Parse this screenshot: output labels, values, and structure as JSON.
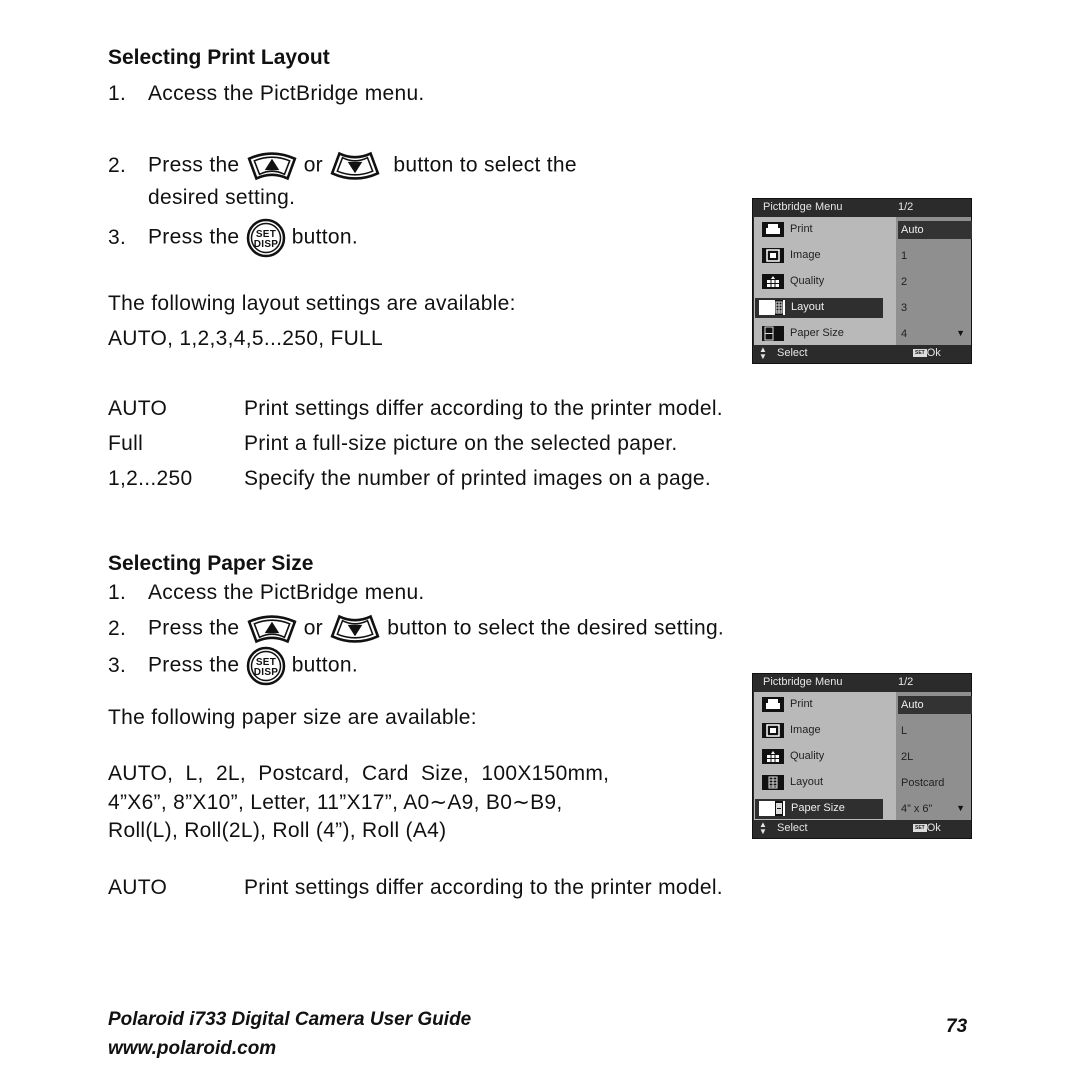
{
  "section1": {
    "heading": "Selecting Print Layout",
    "steps": [
      {
        "num": "1.",
        "text": "Access the PictBridge menu."
      },
      {
        "num": "2.",
        "pre": "Press the",
        "mid": "or",
        "post": "button to select the",
        "cont": "desired setting."
      },
      {
        "num": "3.",
        "pre": "Press the",
        "post": "button."
      }
    ],
    "intro": "The following layout settings are available:",
    "options": "AUTO, 1,2,3,4,5...250, FULL",
    "definitions": [
      {
        "term": "AUTO",
        "desc": "Print settings differ according to the printer model."
      },
      {
        "term": "Full",
        "desc": "Print a full-size picture on the selected paper."
      },
      {
        "term": "1,2...250",
        "desc": "Specify the number of printed images on a page."
      }
    ],
    "menu": {
      "title": "Pictbridge Menu",
      "page": "1/2",
      "items": [
        {
          "label": "Print",
          "icon": "printer-icon"
        },
        {
          "label": "Image",
          "icon": "image-icon"
        },
        {
          "label": "Quality",
          "icon": "quality-icon"
        },
        {
          "label": "Layout",
          "icon": "layout-icon"
        },
        {
          "label": "Paper Size",
          "icon": "paper-size-icon"
        }
      ],
      "selected_index": 3,
      "values": [
        "Auto",
        "1",
        "2",
        "3",
        "4"
      ],
      "selected_value_index": 0,
      "footer_select": "Select",
      "footer_set": "SET",
      "footer_ok": "Ok"
    }
  },
  "section2": {
    "heading": "Selecting Paper Size",
    "steps": [
      {
        "num": "1.",
        "text": "Access the PictBridge menu."
      },
      {
        "num": "2.",
        "pre": "Press the",
        "mid": "or",
        "post": "button to select the desired setting."
      },
      {
        "num": "3.",
        "pre": "Press the",
        "post": "button."
      }
    ],
    "intro": "The following paper size are available:",
    "options_lines": [
      "AUTO,  L,  2L,  Postcard,  Card  Size,  100X150mm,",
      "4”X6”, 8”X10”, Letter, 11”X17”, A0∼A9, B0∼B9,",
      "Roll(L), Roll(2L), Roll (4”), Roll (A4)"
    ],
    "definitions": [
      {
        "term": "AUTO",
        "desc": "Print settings differ according to the printer model."
      }
    ],
    "menu": {
      "title": "Pictbridge Menu",
      "page": "1/2",
      "items": [
        {
          "label": "Print",
          "icon": "printer-icon"
        },
        {
          "label": "Image",
          "icon": "image-icon"
        },
        {
          "label": "Quality",
          "icon": "quality-icon"
        },
        {
          "label": "Layout",
          "icon": "layout-icon"
        },
        {
          "label": "Paper Size",
          "icon": "paper-size-icon"
        }
      ],
      "selected_index": 4,
      "values": [
        "Auto",
        "L",
        "2L",
        "Postcard",
        "4” x 6”"
      ],
      "selected_value_index": 0,
      "footer_select": "Select",
      "footer_set": "SET",
      "footer_ok": "Ok"
    }
  },
  "footer": {
    "title": "Polaroid i733 Digital Camera User Guide",
    "url": "www.polaroid.com",
    "page_number": "73"
  }
}
